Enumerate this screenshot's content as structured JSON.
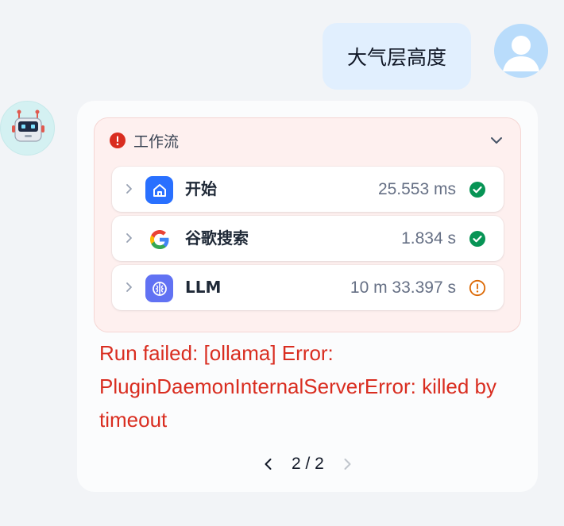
{
  "user_message": {
    "text": "大气层高度"
  },
  "workflow": {
    "title": "工作流",
    "nodes": [
      {
        "label": "开始",
        "time": "25.553 ms",
        "icon": "home-icon",
        "status": "success"
      },
      {
        "label": "谷歌搜索",
        "time": "1.834 s",
        "icon": "google-icon",
        "status": "success"
      },
      {
        "label": "LLM",
        "time": "10 m 33.397 s",
        "icon": "brain-icon",
        "status": "warning"
      }
    ]
  },
  "error_message": "Run failed: [ollama] Error: PluginDaemonInternalServerError: killed by timeout",
  "pagination": {
    "label": "2 / 2"
  },
  "colors": {
    "error": "#d92d20",
    "success": "#079455",
    "warning": "#dc6803",
    "start_icon_bg": "#2970ff",
    "llm_icon_bg": "#6172f3"
  }
}
